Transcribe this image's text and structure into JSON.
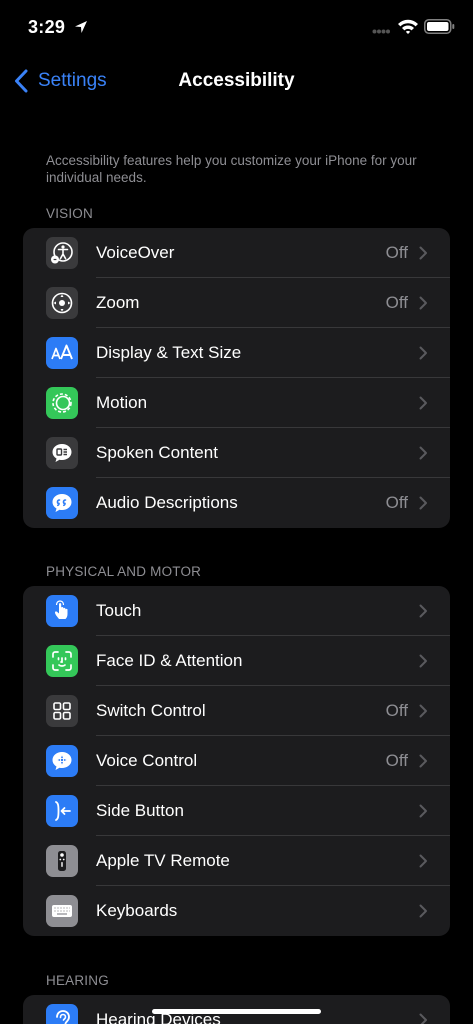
{
  "status": {
    "time": "3:29"
  },
  "nav": {
    "back_label": "Settings",
    "title": "Accessibility"
  },
  "intro": "Accessibility features help you customize your iPhone for your individual needs.",
  "sections": [
    {
      "header": "VISION",
      "rows": [
        {
          "label": "VoiceOver",
          "value": "Off",
          "icon": "voiceover-icon",
          "color": "#3a3a3c"
        },
        {
          "label": "Zoom",
          "value": "Off",
          "icon": "zoom-icon",
          "color": "#3a3a3c"
        },
        {
          "label": "Display & Text Size",
          "value": "",
          "icon": "text-size-icon",
          "color": "#2c7cf6"
        },
        {
          "label": "Motion",
          "value": "",
          "icon": "motion-icon",
          "color": "#34c759"
        },
        {
          "label": "Spoken Content",
          "value": "",
          "icon": "spoken-content-icon",
          "color": "#3a3a3c"
        },
        {
          "label": "Audio Descriptions",
          "value": "Off",
          "icon": "audio-descriptions-icon",
          "color": "#2c7cf6"
        }
      ]
    },
    {
      "header": "PHYSICAL AND MOTOR",
      "rows": [
        {
          "label": "Touch",
          "value": "",
          "icon": "touch-icon",
          "color": "#2c7cf6"
        },
        {
          "label": "Face ID & Attention",
          "value": "",
          "icon": "face-id-icon",
          "color": "#34c759"
        },
        {
          "label": "Switch Control",
          "value": "Off",
          "icon": "switch-control-icon",
          "color": "#3a3a3c"
        },
        {
          "label": "Voice Control",
          "value": "Off",
          "icon": "voice-control-icon",
          "color": "#2c7cf6"
        },
        {
          "label": "Side Button",
          "value": "",
          "icon": "side-button-icon",
          "color": "#2c7cf6"
        },
        {
          "label": "Apple TV Remote",
          "value": "",
          "icon": "tv-remote-icon",
          "color": "#8e8e93"
        },
        {
          "label": "Keyboards",
          "value": "",
          "icon": "keyboard-icon",
          "color": "#8e8e93"
        }
      ]
    },
    {
      "header": "HEARING",
      "rows": [
        {
          "label": "Hearing Devices",
          "value": "",
          "icon": "ear-icon",
          "color": "#2c7cf6"
        }
      ]
    }
  ]
}
